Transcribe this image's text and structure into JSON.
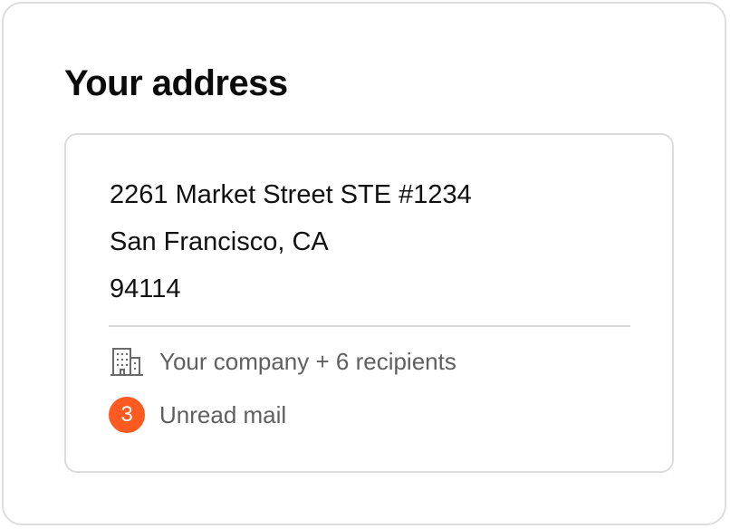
{
  "title": "Your address",
  "address": {
    "line1": "2261 Market Street STE #1234",
    "line2": "San Francisco, CA",
    "line3": "94114"
  },
  "recipients": {
    "icon": "building-icon",
    "label": "Your company + 6 recipients"
  },
  "mail": {
    "unread_count": "3",
    "label": "Unread mail",
    "badge_color": "#ff5a1f"
  },
  "colors": {
    "text": "#111111",
    "muted": "#5f5f5f",
    "border": "#dcdcdc"
  }
}
